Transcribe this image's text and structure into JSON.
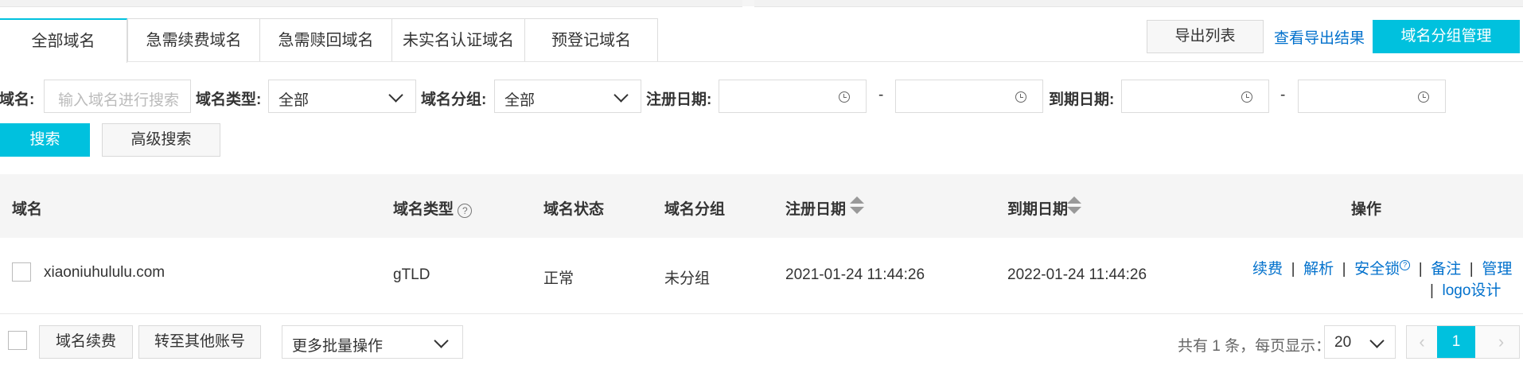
{
  "tabs": [
    "全部域名",
    "急需续费域名",
    "急需赎回域名",
    "未实名认证域名",
    "预登记域名"
  ],
  "actions": {
    "export_list": "导出列表",
    "view_export": "查看导出结果",
    "group_manage": "域名分组管理"
  },
  "filters": {
    "domain_label": "域名:",
    "domain_placeholder": "输入域名进行搜索",
    "type_label": "域名类型:",
    "type_value": "全部",
    "group_label": "域名分组:",
    "group_value": "全部",
    "reg_label": "注册日期:",
    "exp_label": "到期日期:",
    "range_sep": "-",
    "search_btn": "搜索",
    "adv_search_btn": "高级搜索"
  },
  "table": {
    "headers": {
      "domain": "域名",
      "type": "域名类型",
      "status": "域名状态",
      "group": "域名分组",
      "reg_date": "注册日期",
      "exp_date": "到期日期",
      "ops": "操作"
    },
    "rows": [
      {
        "domain": "xiaoniuhululu.com",
        "type": "gTLD",
        "status": "正常",
        "group": "未分组",
        "reg_date": "2021-01-24 11:44:26",
        "exp_date": "2022-01-24 11:44:26",
        "ops": [
          "续费",
          "解析",
          "安全锁",
          "备注",
          "管理",
          "logo设计"
        ]
      }
    ]
  },
  "footer": {
    "renew_btn": "域名续费",
    "transfer_btn": "转至其他账号",
    "batch_select": "更多批量操作",
    "total_text": "共有 1 条，每页显示：",
    "page_size": "20",
    "prev": "‹",
    "current_page": "1",
    "next": "›"
  },
  "colors": {
    "accent": "#00c1de",
    "link": "#0070cc"
  }
}
